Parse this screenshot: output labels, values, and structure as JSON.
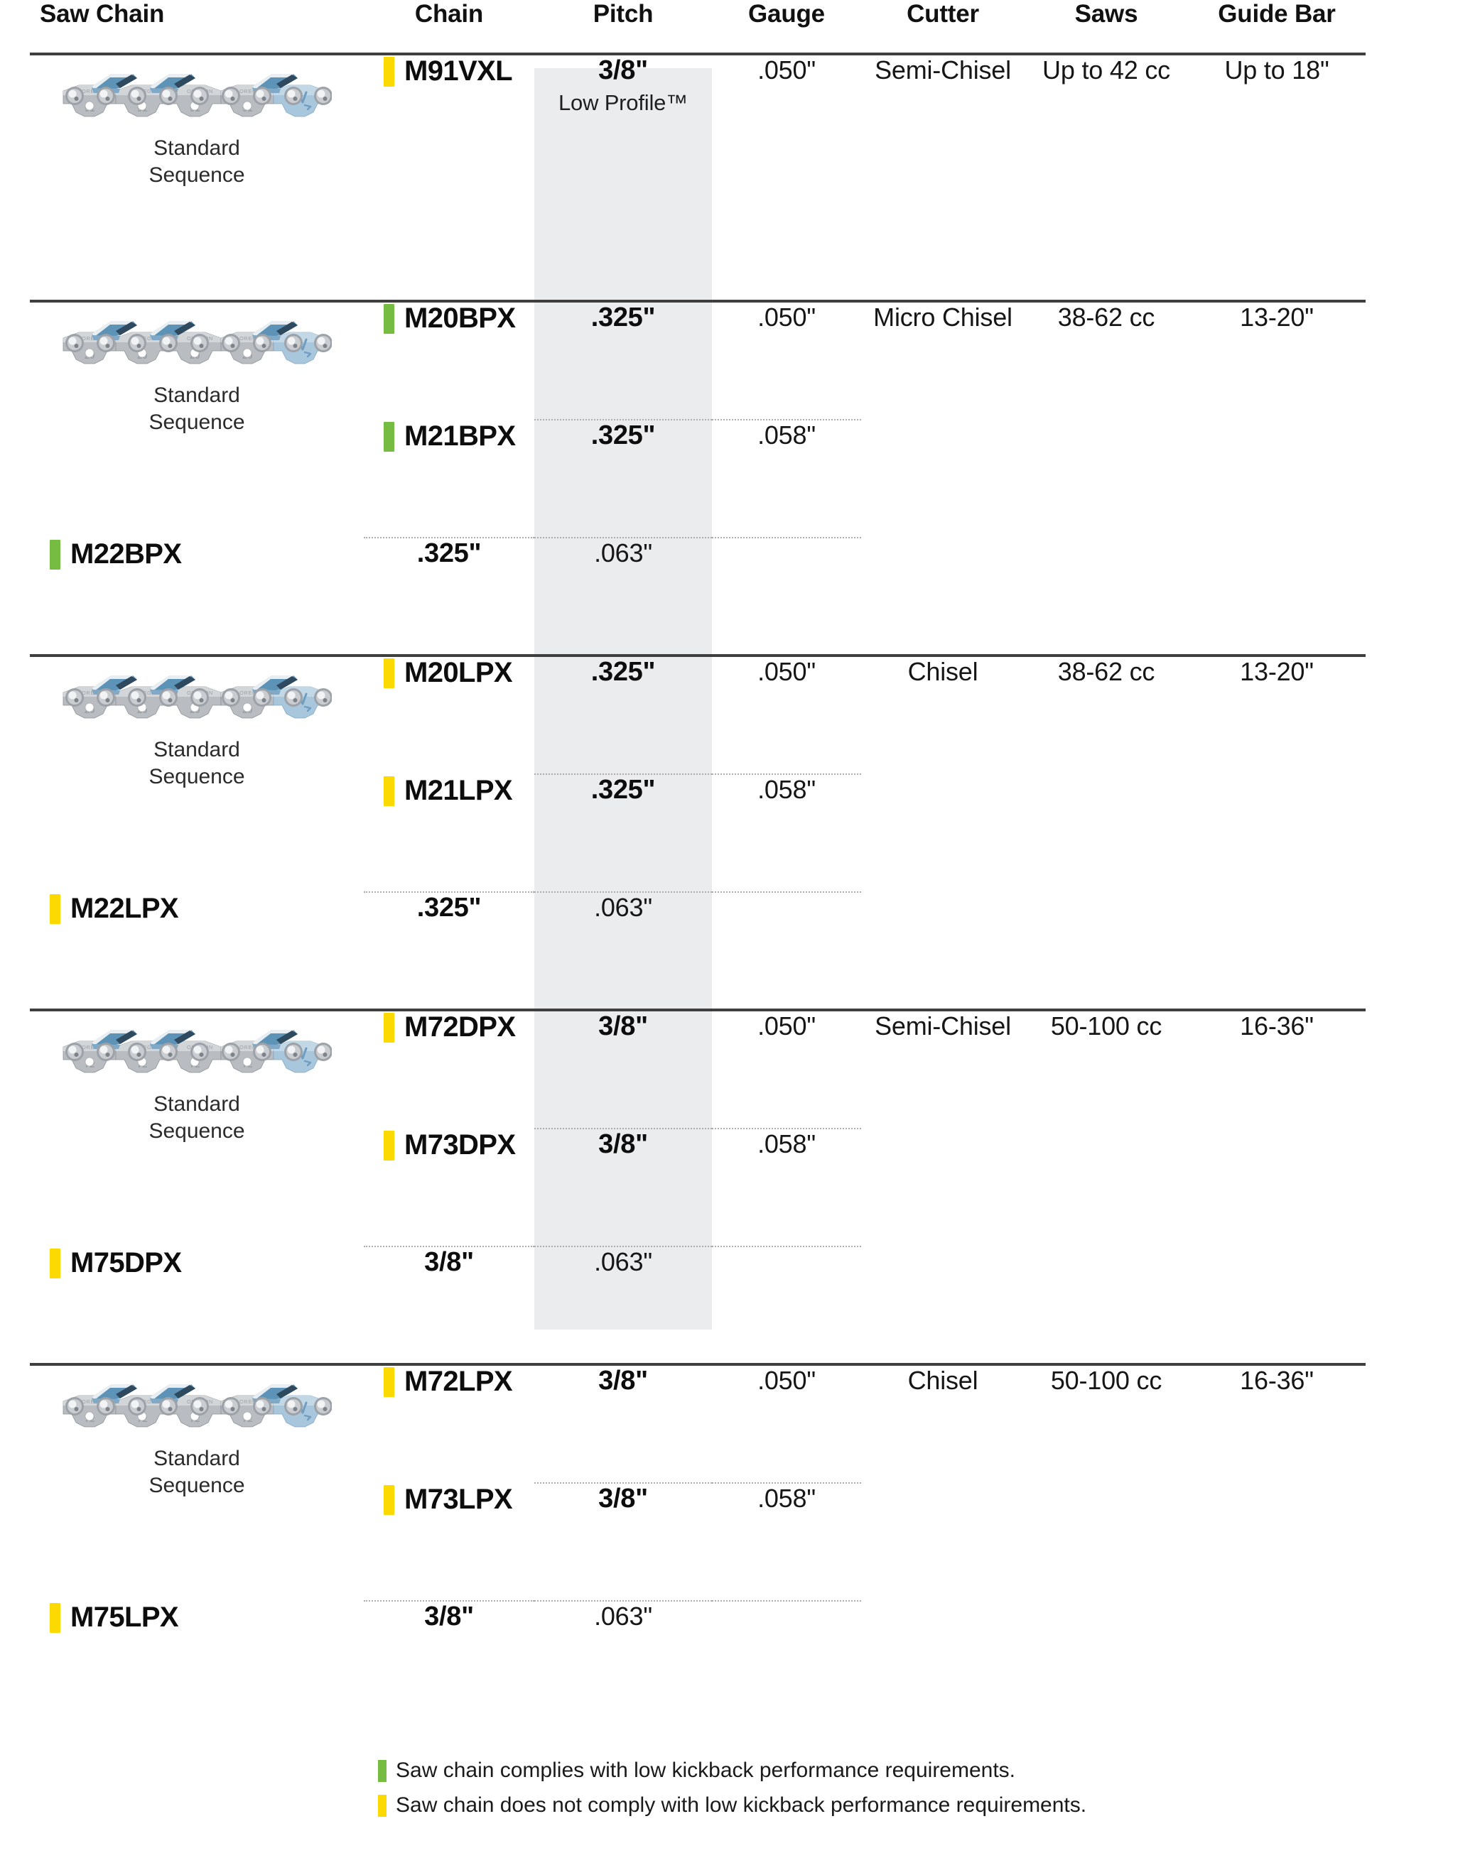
{
  "table": {
    "columns": [
      {
        "key": "saw_chain",
        "label": "Saw Chain",
        "align": "left"
      },
      {
        "key": "chain",
        "label": "Chain",
        "align": "center"
      },
      {
        "key": "pitch",
        "label": "Pitch",
        "align": "center"
      },
      {
        "key": "gauge",
        "label": "Gauge",
        "align": "center"
      },
      {
        "key": "cutter",
        "label": "Cutter",
        "align": "center"
      },
      {
        "key": "saws",
        "label": "Saws",
        "align": "center"
      },
      {
        "key": "guide_bar",
        "label": "Guide Bar",
        "align": "center"
      }
    ],
    "groups": [
      {
        "image_label": "Standard\nSequence",
        "image_caption_line1": "Standard",
        "image_caption_line2": "Sequence",
        "chain_image_number": "91",
        "chain_image_brand": "OREGON",
        "cutter": "Semi-Chisel",
        "saws": "Up to 42 cc",
        "guide_bar": "Up to 18\"",
        "rows": [
          {
            "chain": "M91VXL",
            "kickback": "no-comply",
            "swatch_color": "#fcd900",
            "pitch": "3/8\"",
            "pitch_sub": "Low Profile™",
            "gauge": ".050\""
          }
        ]
      },
      {
        "image_label": "Standard\nSequence",
        "image_caption_line1": "Standard",
        "image_caption_line2": "Sequence",
        "chain_image_number": "20",
        "chain_image_brand": "OREGON",
        "cutter": "Micro Chisel",
        "saws": "38-62 cc",
        "guide_bar": "13-20\"",
        "rows": [
          {
            "chain": "M20BPX",
            "kickback": "comply",
            "swatch_color": "#76bc43",
            "pitch": ".325\"",
            "pitch_sub": "",
            "gauge": ".050\""
          },
          {
            "chain": "M21BPX",
            "kickback": "comply",
            "swatch_color": "#76bc43",
            "pitch": ".325\"",
            "pitch_sub": "",
            "gauge": ".058\""
          },
          {
            "chain": "M22BPX",
            "kickback": "comply",
            "swatch_color": "#76bc43",
            "pitch": ".325\"",
            "pitch_sub": "",
            "gauge": ".063\""
          }
        ]
      },
      {
        "image_label": "Standard\nSequence",
        "image_caption_line1": "Standard",
        "image_caption_line2": "Sequence",
        "chain_image_number": "20",
        "chain_image_brand": "OREGON",
        "cutter": "Chisel",
        "saws": "38-62 cc",
        "guide_bar": "13-20\"",
        "rows": [
          {
            "chain": "M20LPX",
            "kickback": "no-comply",
            "swatch_color": "#fcd900",
            "pitch": ".325\"",
            "pitch_sub": "",
            "gauge": ".050\""
          },
          {
            "chain": "M21LPX",
            "kickback": "no-comply",
            "swatch_color": "#fcd900",
            "pitch": ".325\"",
            "pitch_sub": "",
            "gauge": ".058\""
          },
          {
            "chain": "M22LPX",
            "kickback": "no-comply",
            "swatch_color": "#fcd900",
            "pitch": ".325\"",
            "pitch_sub": "",
            "gauge": ".063\""
          }
        ]
      },
      {
        "image_label": "Standard\nSequence",
        "image_caption_line1": "Standard",
        "image_caption_line2": "Sequence",
        "chain_image_number": "72",
        "chain_image_brand": "OREGON",
        "cutter": "Semi-Chisel",
        "saws": "50-100 cc",
        "guide_bar": "16-36\"",
        "rows": [
          {
            "chain": "M72DPX",
            "kickback": "no-comply",
            "swatch_color": "#fcd900",
            "pitch": "3/8\"",
            "pitch_sub": "",
            "gauge": ".050\""
          },
          {
            "chain": "M73DPX",
            "kickback": "no-comply",
            "swatch_color": "#fcd900",
            "pitch": "3/8\"",
            "pitch_sub": "",
            "gauge": ".058\""
          },
          {
            "chain": "M75DPX",
            "kickback": "no-comply",
            "swatch_color": "#fcd900",
            "pitch": "3/8\"",
            "pitch_sub": "",
            "gauge": ".063\""
          }
        ]
      },
      {
        "image_label": "Standard\nSequence",
        "image_caption_line1": "Standard",
        "image_caption_line2": "Sequence",
        "chain_image_number": "72",
        "chain_image_brand": "OREGON",
        "cutter": "Chisel",
        "saws": "50-100 cc",
        "guide_bar": "16-36\"",
        "rows": [
          {
            "chain": "M72LPX",
            "kickback": "no-comply",
            "swatch_color": "#fcd900",
            "pitch": "3/8\"",
            "pitch_sub": "",
            "gauge": ".050\""
          },
          {
            "chain": "M73LPX",
            "kickback": "no-comply",
            "swatch_color": "#fcd900",
            "pitch": "3/8\"",
            "pitch_sub": "",
            "gauge": ".058\""
          },
          {
            "chain": "M75LPX",
            "kickback": "no-comply",
            "swatch_color": "#fcd900",
            "pitch": "3/8\"",
            "pitch_sub": "",
            "gauge": ".063\""
          }
        ]
      }
    ]
  },
  "legend": {
    "items": [
      {
        "swatch_color": "#76bc43",
        "text": "Saw chain complies with low kickback performance requirements."
      },
      {
        "swatch_color": "#fcd900",
        "text": "Saw chain does not comply with low kickback performance requirements."
      }
    ]
  },
  "colors": {
    "comply_green": "#76bc43",
    "no_comply_yellow": "#fcd900",
    "pitch_band": "#eaeced",
    "rule": "#3f3f3f",
    "dotted_rule": "#adadad"
  }
}
